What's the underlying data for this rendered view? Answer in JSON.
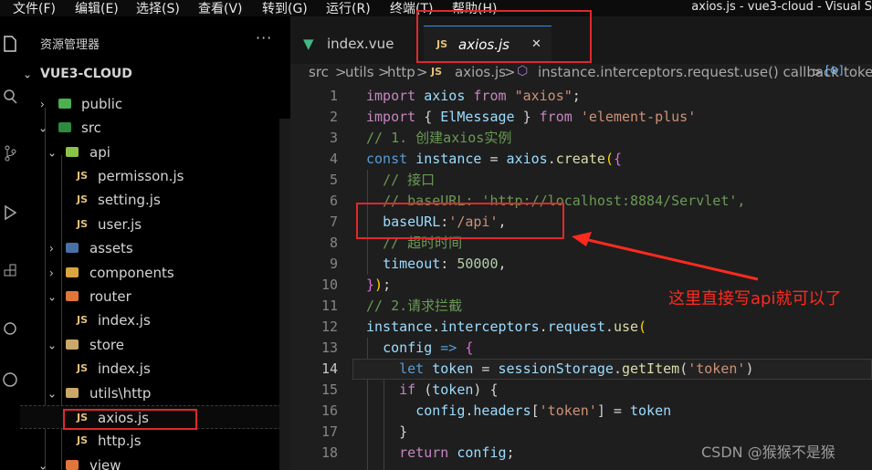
{
  "menu": [
    "文件(F)",
    "编辑(E)",
    "选择(S)",
    "查看(V)",
    "转到(G)",
    "运行(R)",
    "终端(T)",
    "帮助(H)"
  ],
  "window_title": "axios.js - vue3-cloud - Visual S",
  "sidebar": {
    "title": "资源管理器",
    "more": "···",
    "root": "VUE3-CLOUD",
    "items": [
      {
        "label": "public"
      },
      {
        "label": "src"
      },
      {
        "label": "api"
      },
      {
        "label": "permisson.js"
      },
      {
        "label": "setting.js"
      },
      {
        "label": "user.js"
      },
      {
        "label": "assets"
      },
      {
        "label": "components"
      },
      {
        "label": "router"
      },
      {
        "label": "index.js"
      },
      {
        "label": "store"
      },
      {
        "label": "index.js"
      },
      {
        "label": "utils\\http"
      },
      {
        "label": "axios.js"
      },
      {
        "label": "http.js"
      },
      {
        "label": "view"
      }
    ]
  },
  "tabs": [
    {
      "label": "index.vue"
    },
    {
      "label": "axios.js",
      "close": "✕"
    }
  ],
  "breadcrumbs": {
    "src": "src",
    "utils": "utils",
    "http": "http",
    "file": "axios.js",
    "symbol": "instance.interceptors.request.use() callback",
    "tail": "toke",
    "sep": ">"
  },
  "editor": {
    "line_numbers": [
      "1",
      "2",
      "3",
      "4",
      "5",
      "6",
      "7",
      "8",
      "9",
      "10",
      "11",
      "12",
      "13",
      "14",
      "15",
      "16",
      "17",
      "18"
    ],
    "current_line": 14,
    "lines": [
      [
        [
          "kw2",
          "import"
        ],
        [
          "pl",
          " "
        ],
        [
          "var",
          "axios"
        ],
        [
          "pl",
          " "
        ],
        [
          "kw2",
          "from"
        ],
        [
          "pl",
          " "
        ],
        [
          "str",
          "\"axios\""
        ],
        [
          "pl",
          ";"
        ]
      ],
      [
        [
          "kw2",
          "import"
        ],
        [
          "pl",
          " { "
        ],
        [
          "var",
          "ElMessage"
        ],
        [
          "pl",
          " } "
        ],
        [
          "kw2",
          "from"
        ],
        [
          "pl",
          " "
        ],
        [
          "str",
          "'element-plus'"
        ]
      ],
      [
        [
          "cm",
          "// 1. 创建axios实例"
        ]
      ],
      [
        [
          "kw",
          "const"
        ],
        [
          "pl",
          " "
        ],
        [
          "var",
          "instance"
        ],
        [
          "pl",
          " = "
        ],
        [
          "var",
          "axios"
        ],
        [
          "pl",
          "."
        ],
        [
          "fn",
          "create"
        ],
        [
          "br",
          "("
        ],
        [
          "br2",
          "{"
        ]
      ],
      [
        [
          "pl",
          "  "
        ],
        [
          "cm",
          "// 接口"
        ]
      ],
      [
        [
          "pl",
          "  "
        ],
        [
          "cm",
          "// baseURL: 'http://localhost:8884/Servlet',"
        ]
      ],
      [
        [
          "pl",
          "  "
        ],
        [
          "var",
          "baseURL"
        ],
        [
          "pl",
          ":"
        ],
        [
          "str",
          "'/api'"
        ],
        [
          "pl",
          ","
        ]
      ],
      [
        [
          "pl",
          "  "
        ],
        [
          "cm",
          "// 超时时间"
        ]
      ],
      [
        [
          "pl",
          "  "
        ],
        [
          "var",
          "timeout"
        ],
        [
          "pl",
          ": "
        ],
        [
          "num",
          "50000"
        ],
        [
          "pl",
          ","
        ]
      ],
      [
        [
          "br2",
          "}"
        ],
        [
          "br",
          ")"
        ],
        [
          "pl",
          ";"
        ]
      ],
      [
        [
          "cm",
          "// 2.请求拦截"
        ]
      ],
      [
        [
          "var",
          "instance"
        ],
        [
          "pl",
          "."
        ],
        [
          "var",
          "interceptors"
        ],
        [
          "pl",
          "."
        ],
        [
          "var",
          "request"
        ],
        [
          "pl",
          "."
        ],
        [
          "fn",
          "use"
        ],
        [
          "br",
          "("
        ]
      ],
      [
        [
          "pl",
          "  "
        ],
        [
          "var",
          "config"
        ],
        [
          "pl",
          " "
        ],
        [
          "kw",
          "=>"
        ],
        [
          "pl",
          " "
        ],
        [
          "br2",
          "{"
        ]
      ],
      [
        [
          "pl",
          "    "
        ],
        [
          "kw",
          "let"
        ],
        [
          "pl",
          " "
        ],
        [
          "var",
          "token"
        ],
        [
          "pl",
          " = "
        ],
        [
          "var",
          "sessionStorage"
        ],
        [
          "pl",
          "."
        ],
        [
          "fn",
          "getItem"
        ],
        [
          "pl",
          "("
        ],
        [
          "str",
          "'token'"
        ],
        [
          "pl",
          ")"
        ]
      ],
      [
        [
          "pl",
          "    "
        ],
        [
          "kw2",
          "if"
        ],
        [
          "pl",
          " ("
        ],
        [
          "var",
          "token"
        ],
        [
          "pl",
          ") {"
        ]
      ],
      [
        [
          "pl",
          "      "
        ],
        [
          "var",
          "config"
        ],
        [
          "pl",
          "."
        ],
        [
          "var",
          "headers"
        ],
        [
          "pl",
          "["
        ],
        [
          "str",
          "'token'"
        ],
        [
          "pl",
          "] = "
        ],
        [
          "var",
          "token"
        ]
      ],
      [
        [
          "pl",
          "    }"
        ]
      ],
      [
        [
          "pl",
          "    "
        ],
        [
          "kw2",
          "return"
        ],
        [
          "pl",
          " "
        ],
        [
          "var",
          "config"
        ],
        [
          "pl",
          ";"
        ]
      ]
    ]
  },
  "annotation": "这里直接写api就可以了",
  "watermark": "CSDN @猴猴不是猴",
  "colors": {
    "annotation": "#ff2a1f",
    "highlight_box": "#e0282c"
  }
}
